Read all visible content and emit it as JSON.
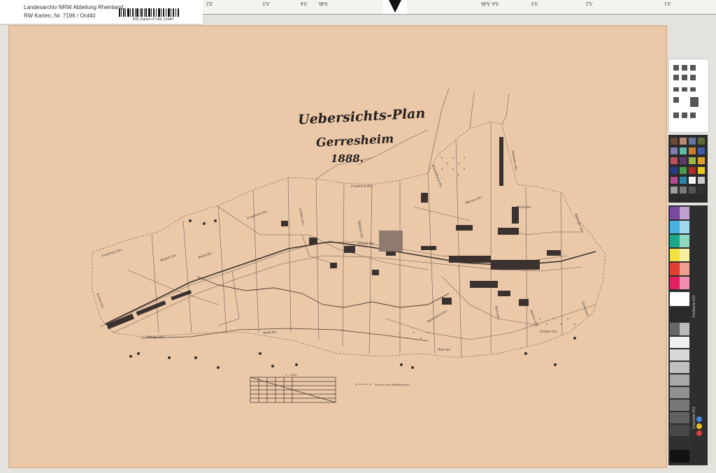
{
  "archive": {
    "line1": "Landesarchiv NRW Abteilung Rheinland",
    "line2": "RW Karten, Nr. 7196 / Ord40",
    "barcode_text": "RW_Karten-07196_Ord40"
  },
  "ruler": {
    "labels": [
      "A2",
      "A3",
      "A4",
      "A4h",
      "A4h",
      "A4",
      "A3",
      "A2",
      "A1"
    ]
  },
  "map": {
    "title": "Uebersichts-Plan",
    "subtitle": "Gerresheim",
    "year": "1888.",
    "scale_label": "1 : 2500",
    "legend_note": "Grenze des Stadtbezirks",
    "street_labels": [
      "Friedrich-Str.",
      "Kapell-Str.",
      "Bahn-Str.",
      "Königs-Str.",
      "Wald-Str.",
      "Haupt-Str.",
      "Kirch-Str.",
      "Hasselbeck-Str.",
      "Marien-Str.",
      "Benrather-Str.",
      "Wein-Str.",
      "Dreher-Str.",
      "Ratinger-Str.",
      "Schön-Str.",
      "Neander-Str.",
      "Post-Str.",
      "Linden-Str.",
      "Gartenstr.",
      "Mühlen-Str.",
      "Rather-Str."
    ]
  },
  "color_target": {
    "strip_label": "Graustufe #13",
    "scale_label": "Farbkarte #13"
  },
  "colors": {
    "paper": "#ebc9a8",
    "ink": "#2a2424",
    "background": "#e4e2dc"
  }
}
